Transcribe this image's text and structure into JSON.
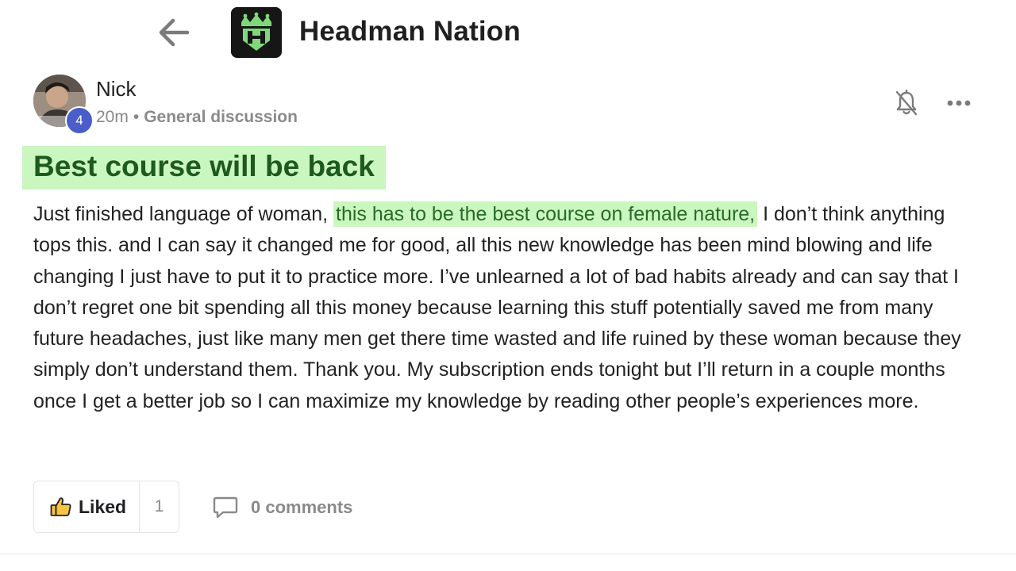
{
  "header": {
    "back_icon": "arrow-left-icon",
    "logo_icon": "headman-crown-shield-logo",
    "group_name": "Headman Nation"
  },
  "post": {
    "author": {
      "name": "Nick",
      "level": "4",
      "time_ago": "20m",
      "separator": "•",
      "category": "General discussion"
    },
    "icons": {
      "notifications": "bell-off-icon",
      "more": "more-horizontal-icon"
    },
    "title": "Best course will be back",
    "body_before": "Just finished language of woman, ",
    "body_highlight": "this has to be the best course on female nature,",
    "body_after": " I don’t think anything tops this. and I can say it changed me for good, all this new knowledge has been mind blowing and life changing I just have to put it to practice more. I’ve unlearned a lot of bad habits already and can say that I don’t regret one bit spending all this money because learning this stuff potentially saved me from many future headaches, just like many men get there time wasted and life ruined by these woman because they simply don’t understand them. Thank you. My subscription ends tonight but I’ll return in a couple months once I get a better job so I can maximize my knowledge by reading other people’s experiences more.",
    "highlight_color": "#c9f7bf"
  },
  "actions": {
    "like_icon": "thumbs-up-icon",
    "like_label": "Liked",
    "like_count": "1",
    "comment_icon": "comment-bubble-icon",
    "comments_label": "0 comments"
  },
  "colors": {
    "title_text": "#1f5a1d",
    "badge": "#4a5dc8",
    "muted": "#8a8a8a"
  }
}
